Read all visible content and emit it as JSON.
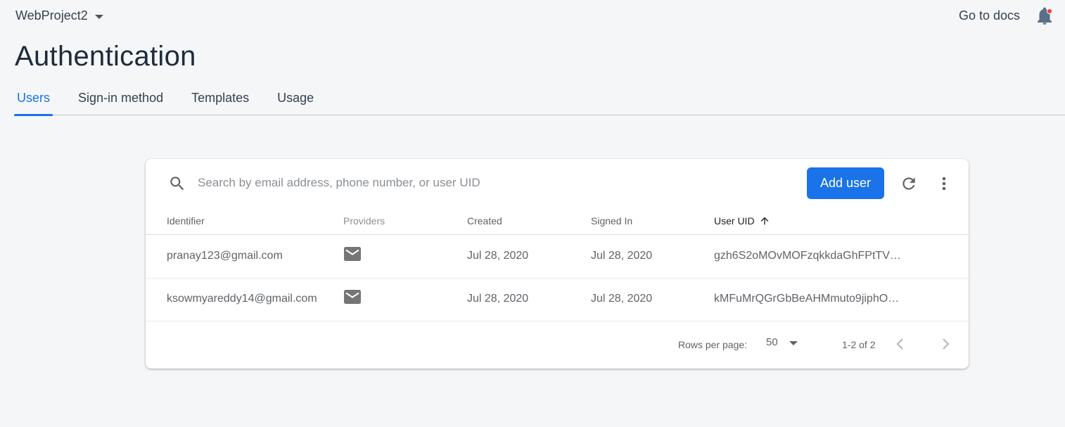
{
  "header": {
    "project_name": "WebProject2",
    "docs_link": "Go to docs",
    "title": "Authentication"
  },
  "tabs": [
    {
      "label": "Users",
      "active": true
    },
    {
      "label": "Sign-in method",
      "active": false
    },
    {
      "label": "Templates",
      "active": false
    },
    {
      "label": "Usage",
      "active": false
    }
  ],
  "toolbar": {
    "search_placeholder": "Search by email address, phone number, or user UID",
    "search_value": "",
    "add_user_label": "Add user"
  },
  "table": {
    "columns": [
      "Identifier",
      "Providers",
      "Created",
      "Signed In",
      "User UID"
    ],
    "sorted_column": "User UID",
    "sort_direction": "ascending",
    "rows": [
      {
        "identifier": "pranay123@gmail.com",
        "provider_icon": "email-icon",
        "created": "Jul 28, 2020",
        "signed_in": "Jul 28, 2020",
        "uid": "gzh6S2oMOvMOFzqkkdaGhFPtTV…"
      },
      {
        "identifier": "ksowmyareddy14@gmail.com",
        "provider_icon": "email-icon",
        "created": "Jul 28, 2020",
        "signed_in": "Jul 28, 2020",
        "uid": "kMFuMrQGrGbBeAHMmuto9jiphO…"
      }
    ]
  },
  "pagination": {
    "rows_per_page_label": "Rows per page:",
    "rows_per_page_value": "50",
    "range": "1-2 of 2"
  },
  "colors": {
    "accent": "#1a73e8",
    "notification_dot": "#ea4335",
    "background": "#f5f6f8"
  }
}
